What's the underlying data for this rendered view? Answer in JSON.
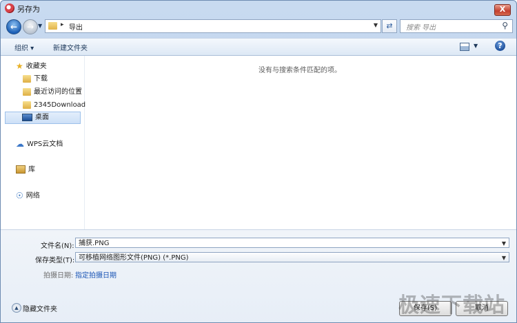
{
  "window": {
    "title": "另存为",
    "close_label": "X"
  },
  "navbar": {
    "address_path": "导出",
    "search_placeholder": "搜索 导出"
  },
  "toolbar": {
    "organize_label": "组织 ▾",
    "new_folder_label": "新建文件夹"
  },
  "sidebar": {
    "items": [
      {
        "label": "收藏夹",
        "icon": "star-icon"
      },
      {
        "label": "下载",
        "icon": "download-folder-icon"
      },
      {
        "label": "最近访问的位置",
        "icon": "recent-places-icon"
      },
      {
        "label": "2345Download",
        "icon": "folder-icon"
      },
      {
        "label": "桌面",
        "icon": "desktop-icon",
        "selected": true
      },
      {
        "label": "WPS云文档",
        "icon": "cloud-icon"
      },
      {
        "label": "库",
        "icon": "library-icon"
      },
      {
        "label": "网络",
        "icon": "network-icon"
      }
    ]
  },
  "main": {
    "empty_message": "没有与搜索条件匹配的项。"
  },
  "form": {
    "filename_label": "文件名(N):",
    "filename_value": "捕获.PNG",
    "filetype_label": "保存类型(T):",
    "filetype_value": "可移植网络图形文件(PNG) (*.PNG)",
    "date_label": "拍摄日期:",
    "date_link": "指定拍摄日期"
  },
  "footer": {
    "hide_folders_label": "隐藏文件夹",
    "save_label": "保存(S)",
    "cancel_label": "取消"
  },
  "watermark": "极速下载站"
}
